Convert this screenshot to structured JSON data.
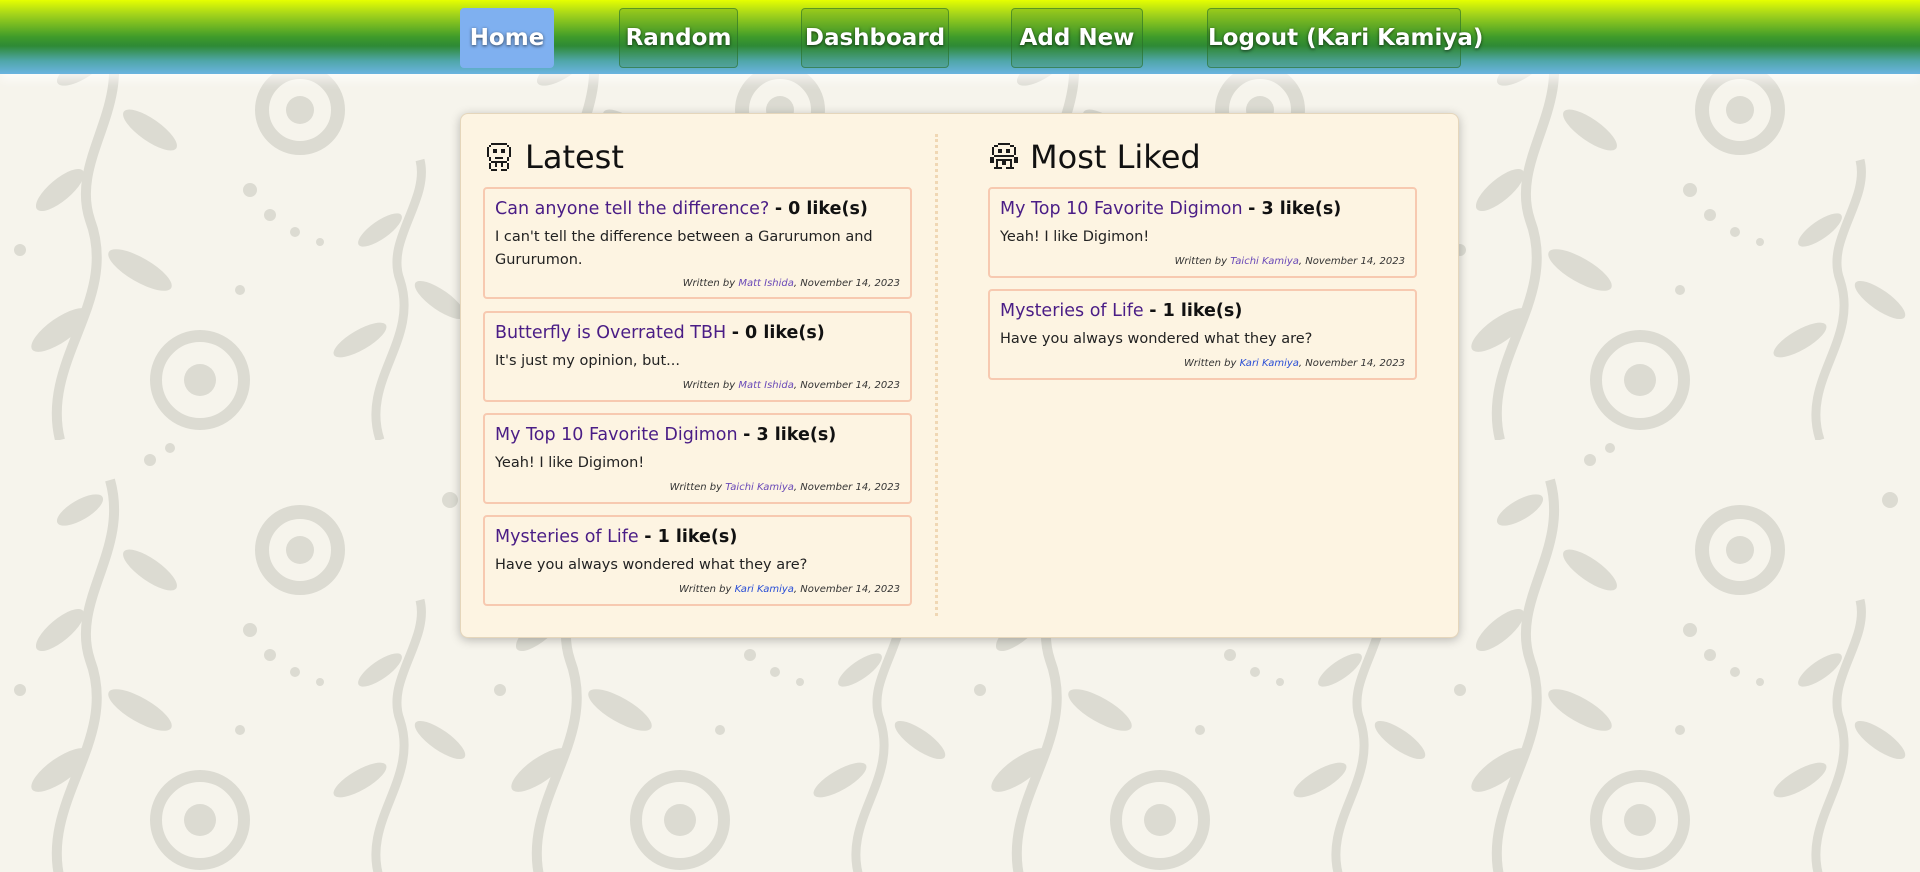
{
  "colors": {
    "nav_active": "#7fb0f0",
    "post_title": "#4a1d86",
    "card_border": "#f7c9b0",
    "panel_bg": "#fdf4e2",
    "page_bg": "#f6f4ec"
  },
  "nav": {
    "items": [
      {
        "label": "Home",
        "active": true
      },
      {
        "label": "Random"
      },
      {
        "label": "Dashboard"
      },
      {
        "label": "Add New"
      },
      {
        "label": "Logout (Kari Kamiya)"
      }
    ]
  },
  "latest": {
    "title": "Latest",
    "icon": "digimon-sprite-icon",
    "posts": [
      {
        "title": "Can anyone tell the difference?",
        "likes": "- 0 like(s)",
        "body": "I can't tell the difference between a Garurumon and Gururumon.",
        "written_by": "Written by",
        "author": "Matt Ishida",
        "date": ", November 14, 2023"
      },
      {
        "title": "Butterfly is Overrated TBH",
        "likes": "- 0 like(s)",
        "body": "It's just my opinion, but...",
        "written_by": "Written by",
        "author": "Matt Ishida",
        "date": ", November 14, 2023"
      },
      {
        "title": "My Top 10 Favorite Digimon",
        "likes": "- 3 like(s)",
        "body": "Yeah! I like Digimon!",
        "written_by": "Written by",
        "author": "Taichi Kamiya",
        "date": ", November 14, 2023"
      },
      {
        "title": "Mysteries of Life",
        "likes": "- 1 like(s)",
        "body": "Have you always wondered what they are?",
        "written_by": "Written by",
        "author": "Kari Kamiya",
        "date": ", November 14, 2023"
      }
    ]
  },
  "most_liked": {
    "title": "Most Liked",
    "icon": "digimon-sprite-icon",
    "posts": [
      {
        "title": "My Top 10 Favorite Digimon",
        "likes": "- 3 like(s)",
        "body": "Yeah! I like Digimon!",
        "written_by": "Written by",
        "author": "Taichi Kamiya",
        "date": ", November 14, 2023"
      },
      {
        "title": "Mysteries of Life",
        "likes": "- 1 like(s)",
        "body": "Have you always wondered what they are?",
        "written_by": "Written by",
        "author": "Kari Kamiya",
        "date": ", November 14, 2023"
      }
    ]
  }
}
